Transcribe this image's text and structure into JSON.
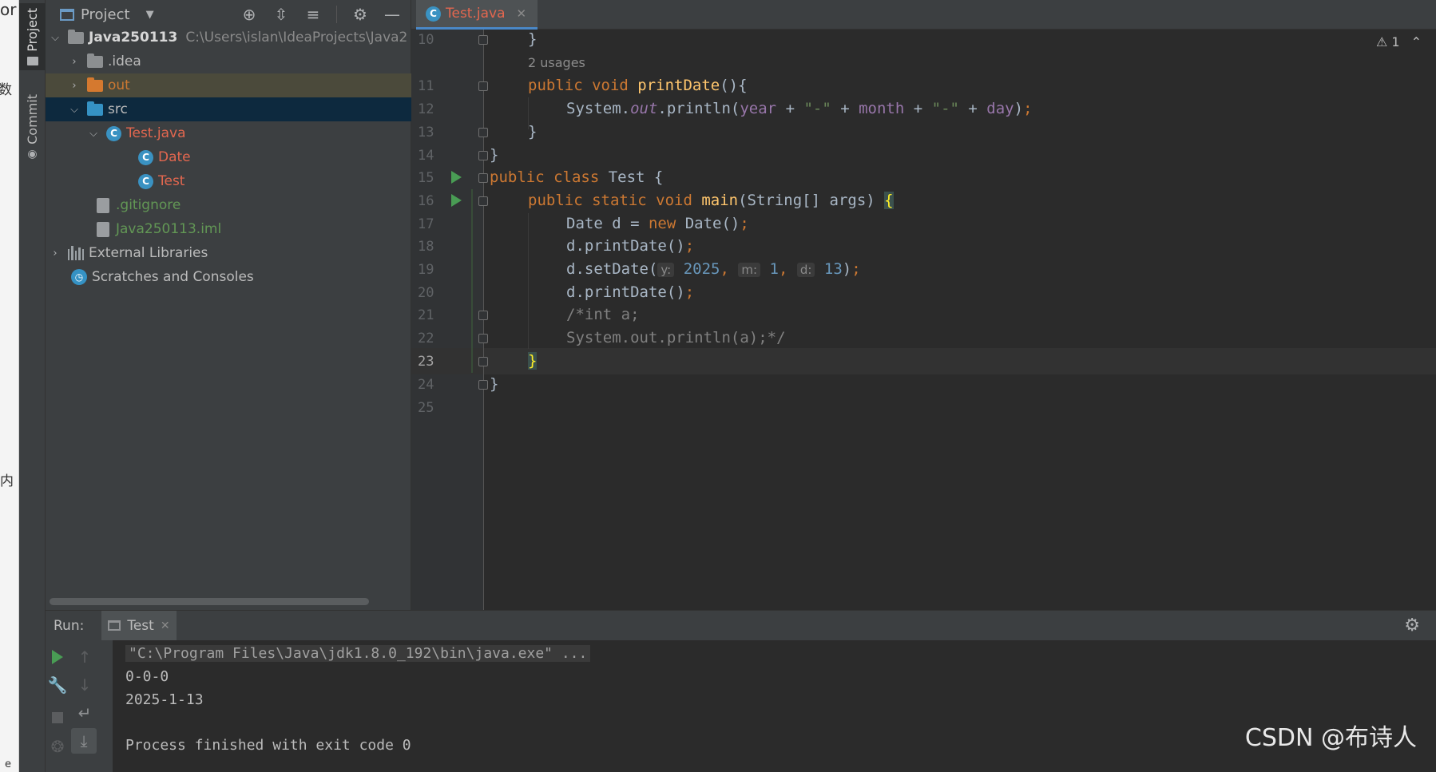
{
  "edge": {
    "top_text": "or",
    "mid_text": "数",
    "low_text": "内",
    "bottom_text": "e"
  },
  "toolstrip": {
    "project_tab": "Project",
    "commit_tab": "Commit"
  },
  "project": {
    "title": "Project",
    "tree": [
      {
        "label": "Java250113",
        "path": "C:\\Users\\islan\\IdeaProjects\\Java2"
      },
      {
        "label": ".idea"
      },
      {
        "label": "out"
      },
      {
        "label": "src"
      },
      {
        "label": "Test.java"
      },
      {
        "label": "Date"
      },
      {
        "label": "Test"
      },
      {
        "label": ".gitignore"
      },
      {
        "label": "Java250113.iml"
      },
      {
        "label": "External Libraries"
      },
      {
        "label": "Scratches and Consoles"
      }
    ]
  },
  "editor": {
    "tab_label": "Test.java",
    "warning_count": "1",
    "usages_hint": "2 usages",
    "line_numbers": [
      "10",
      "11",
      "12",
      "13",
      "14",
      "15",
      "16",
      "17",
      "18",
      "19",
      "20",
      "21",
      "22",
      "23",
      "24",
      "25"
    ],
    "code": {
      "l10": "}",
      "l11_kw": "public void ",
      "l11_fn": "printDate",
      "l11_rest": "(){",
      "l12_a": "System.",
      "l12_out": "out",
      "l12_b": ".println(",
      "l12_year": "year",
      "l12_plus1": " + ",
      "l12_s1": "\"-\"",
      "l12_plus2": " + ",
      "l12_month": "month",
      "l12_plus3": " + ",
      "l12_s2": "\"-\"",
      "l12_plus4": " + ",
      "l12_day": "day",
      "l12_end": ")",
      "l12_semi": ";",
      "l13": "}",
      "l14": "}",
      "l15_kw": "public class ",
      "l15_rest": "Test {",
      "l16_kw": "public static void ",
      "l16_fn": "main",
      "l16_rest": "(String[] args) ",
      "l16_brace": "{",
      "l17_a": "Date d = ",
      "l17_kw": "new ",
      "l17_b": "Date()",
      "l17_semi": ";",
      "l18_a": "d.printDate()",
      "l18_semi": ";",
      "l19_a": "d.setDate(",
      "l19_hy": "y:",
      "l19_vy": "2025",
      "l19_c1": ",",
      "l19_hm": "m:",
      "l19_vm": "1",
      "l19_c2": ",",
      "l19_hd": "d:",
      "l19_vd": "13",
      "l19_end": ")",
      "l19_semi": ";",
      "l20_a": "d.printDate()",
      "l20_semi": ";",
      "l21": "/*int a;",
      "l22": "System.out.println(a);*/",
      "l23": "}",
      "l24": "}"
    }
  },
  "run": {
    "label": "Run:",
    "tab": "Test",
    "output": [
      "\"C:\\Program Files\\Java\\jdk1.8.0_192\\bin\\java.exe\" ...",
      "0-0-0",
      "2025-1-13",
      "",
      "Process finished with exit code 0"
    ]
  },
  "watermark": "CSDN @布诗人",
  "colors": {
    "accent": "#4a88c7",
    "run_green": "#499c54",
    "keyword": "#cc7832",
    "function": "#ffc66d",
    "field": "#9876aa",
    "string": "#6a8759",
    "number": "#6897bb"
  }
}
